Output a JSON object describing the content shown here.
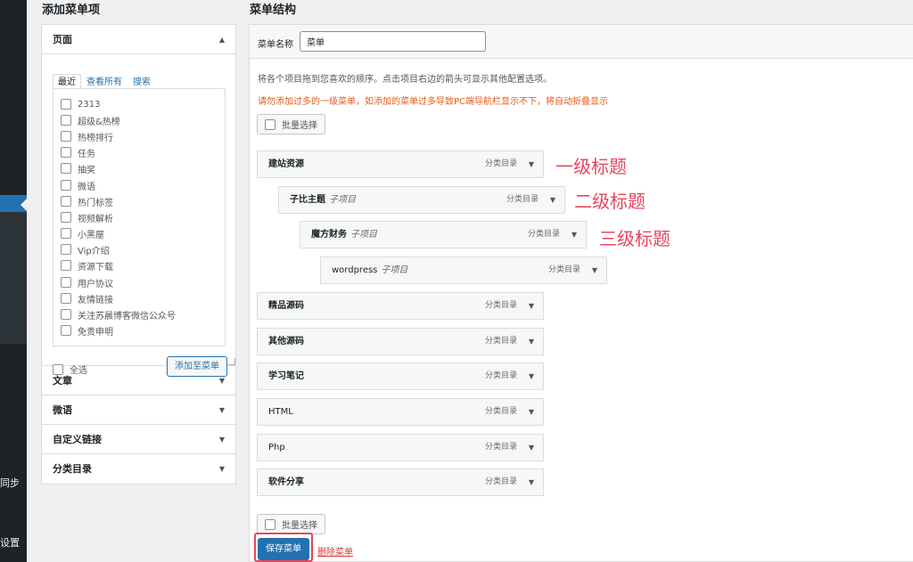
{
  "sidebar": {
    "items": [
      {
        "label": "同步"
      },
      {
        "label": "设置"
      }
    ]
  },
  "add_items": {
    "title": "添加菜单项",
    "pages_section": {
      "label": "页面",
      "tabs": [
        {
          "label": "最近"
        },
        {
          "label": "查看所有"
        },
        {
          "label": "搜索"
        }
      ],
      "items": [
        {
          "label": "2313"
        },
        {
          "label": "超级&热榜"
        },
        {
          "label": "热榜排行"
        },
        {
          "label": "任务"
        },
        {
          "label": "抽奖"
        },
        {
          "label": "微语"
        },
        {
          "label": "热门标签"
        },
        {
          "label": "视频解析"
        },
        {
          "label": "小黑屋"
        },
        {
          "label": "Vip介绍"
        },
        {
          "label": "资源下载"
        },
        {
          "label": "用户协议"
        },
        {
          "label": "友情链接"
        },
        {
          "label": "关注苏晨博客微信公众号"
        },
        {
          "label": "免责申明"
        }
      ],
      "select_all": "全选",
      "add_button": "添加至菜单"
    },
    "sections": [
      {
        "label": "文章"
      },
      {
        "label": "微语"
      },
      {
        "label": "自定义链接"
      },
      {
        "label": "分类目录"
      }
    ]
  },
  "structure": {
    "title": "菜单结构",
    "name_label": "菜单名称",
    "name_value": "菜单",
    "instructions": "将各个项目拖到您喜欢的顺序。点击项目右边的箭头可显示其他配置选项。",
    "warning": "请勿添加过多的一级菜单，如添加的菜单过多导致PC端导航栏显示不下，将自动折叠显示",
    "bulk_select": "批量选择",
    "items": [
      {
        "title": "建站资源",
        "sub": "",
        "type": "分类目录"
      },
      {
        "title": "子比主题",
        "sub": "子项目",
        "type": "分类目录"
      },
      {
        "title": "魔方财务",
        "sub": "子项目",
        "type": "分类目录"
      },
      {
        "title": "wordpress",
        "sub": "子项目",
        "type": "分类目录"
      },
      {
        "title": "精品源码",
        "sub": "",
        "type": "分类目录"
      },
      {
        "title": "其他源码",
        "sub": "",
        "type": "分类目录"
      },
      {
        "title": "学习笔记",
        "sub": "",
        "type": "分类目录"
      },
      {
        "title": "HTML",
        "sub": "",
        "type": "分类目录"
      },
      {
        "title": "Php",
        "sub": "",
        "type": "分类目录"
      },
      {
        "title": "软件分享",
        "sub": "",
        "type": "分类目录"
      }
    ],
    "annotations": [
      {
        "text": "一级标题"
      },
      {
        "text": "二级标题"
      },
      {
        "text": "三级标题"
      }
    ],
    "save_button": "保存菜单",
    "delete_link": "删除菜单"
  },
  "colors": {
    "accent": "#2271b1",
    "annotation": "#e8455c",
    "warning": "#e35d1a",
    "delete": "#d63638"
  }
}
